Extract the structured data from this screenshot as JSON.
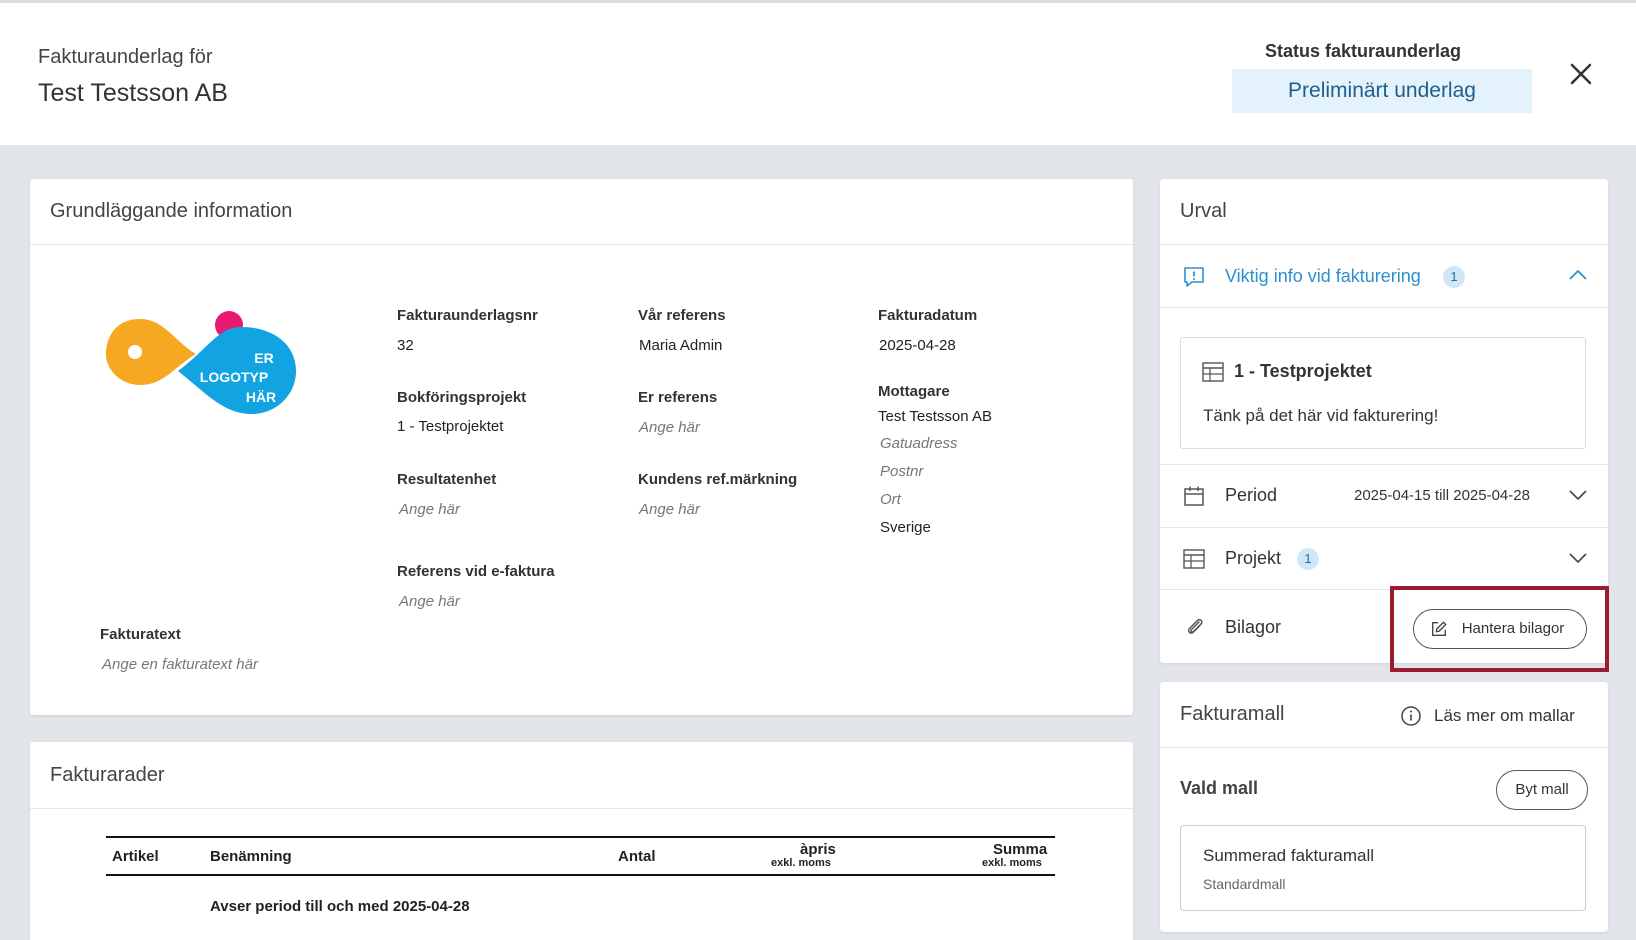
{
  "header": {
    "subtitle": "Fakturaunderlag för",
    "title": "Test Testsson AB",
    "status_label": "Status fakturaunderlag",
    "status_value": "Preliminärt underlag"
  },
  "basic_info": {
    "title": "Grundläggande information",
    "logo_text": [
      "ER",
      "LOGOTYP",
      "HÄR"
    ],
    "fields": {
      "underlagsnr_label": "Fakturaunderlagsnr",
      "underlagsnr_value": "32",
      "var_ref_label": "Vår referens",
      "var_ref_value": "Maria Admin",
      "fakturadatum_label": "Fakturadatum",
      "fakturadatum_value": "2025-04-28",
      "bokf_label": "Bokföringsprojekt",
      "bokf_value": "1 - Testprojektet",
      "er_ref_label": "Er referens",
      "er_ref_ph": "Ange här",
      "mottagare_label": "Mottagare",
      "mottagare_name": "Test Testsson AB",
      "gatuadress_ph": "Gatuadress",
      "postnr_ph": "Postnr",
      "ort_ph": "Ort",
      "land": "Sverige",
      "resultatenhet_label": "Resultatenhet",
      "resultatenhet_ph": "Ange här",
      "kundens_ref_label": "Kundens ref.märkning",
      "kundens_ref_ph": "Ange här",
      "efaktura_label": "Referens vid e-faktura",
      "efaktura_ph": "Ange här",
      "fakturatext_label": "Fakturatext",
      "fakturatext_ph": "Ange en fakturatext här"
    }
  },
  "rows": {
    "title": "Fakturarader",
    "columns": {
      "artikel": "Artikel",
      "benamning": "Benämning",
      "antal": "Antal",
      "apris": "àpris",
      "apris_sub": "exkl. moms",
      "summa": "Summa",
      "summa_sub": "exkl. moms"
    },
    "period_row": "Avser period till och med 2025-04-28"
  },
  "urval": {
    "title": "Urval",
    "viktig_info": "Viktig info vid fakturering",
    "viktig_count": "1",
    "project_title": "1 - Testprojektet",
    "project_text": "Tänk på det här vid fakturering!",
    "period_label": "Period",
    "period_value": "2025-04-15 till 2025-04-28",
    "projekt_label": "Projekt",
    "projekt_count": "1",
    "bilagor_label": "Bilagor",
    "hantera_button": "Hantera bilagor"
  },
  "fakturamall": {
    "title": "Fakturamall",
    "las_mer": "Läs mer om mallar",
    "vald_mall": "Vald mall",
    "byt_mall": "Byt mall",
    "mall_name": "Summerad fakturamall",
    "mall_sub": "Standardmall"
  },
  "colors": {
    "accent_blue": "#2e8fd0",
    "status_bg": "#e3f2fb",
    "highlight": "#9b1c2e",
    "logo_orange": "#f7a823",
    "logo_pink": "#e8196f",
    "logo_blue": "#12a3e3"
  }
}
